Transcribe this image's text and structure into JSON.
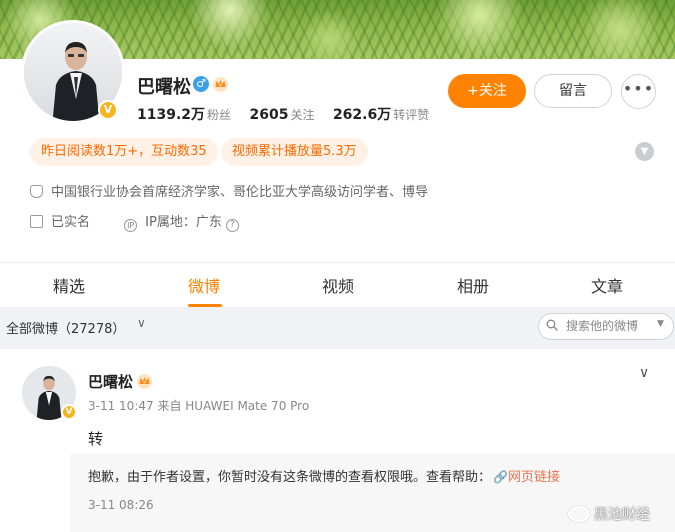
{
  "profile": {
    "name": "巴曙松",
    "gender_icon": "male-icon",
    "verified_badge": "V",
    "stats": [
      {
        "value": "1139.2万",
        "label": "粉丝"
      },
      {
        "value": "2605",
        "label": "关注"
      },
      {
        "value": "262.6万",
        "label": "转评赞"
      }
    ],
    "follow_label": "+关注",
    "message_label": "留言",
    "more_label": "•••",
    "tags": [
      "昨日阅读数1万+，互动数35",
      "视频累计播放量5.3万"
    ],
    "bio": "中国银行业协会首席经济学家、哥伦比亚大学高级访问学者、博导",
    "verified_text": "已实名",
    "ip_location": "IP属地：广东",
    "help_mark": "?"
  },
  "tabs": [
    {
      "label": "精选",
      "active": false
    },
    {
      "label": "微博",
      "active": true
    },
    {
      "label": "视频",
      "active": false
    },
    {
      "label": "相册",
      "active": false
    },
    {
      "label": "文章",
      "active": false
    }
  ],
  "filter": {
    "label": "全部微博（27278）",
    "search_placeholder": "搜索他的微博"
  },
  "post": {
    "author": "巴曙松",
    "time": "3-11 10:47",
    "source": "来自 HUAWEI Mate 70 Pro",
    "text": "转",
    "quote_text": "抱歉，由于作者设置，你暂时没有这条微博的查看权限哦。查看帮助：",
    "link_label": "网页链接",
    "quote_time": "3-11 08:26"
  },
  "watermark": "黑池财经",
  "colors": {
    "accent": "#ff8200",
    "tag_bg": "#fff1e6",
    "link": "#eb7350",
    "verified": "#f6b51e",
    "male": "#3aa0e8"
  }
}
